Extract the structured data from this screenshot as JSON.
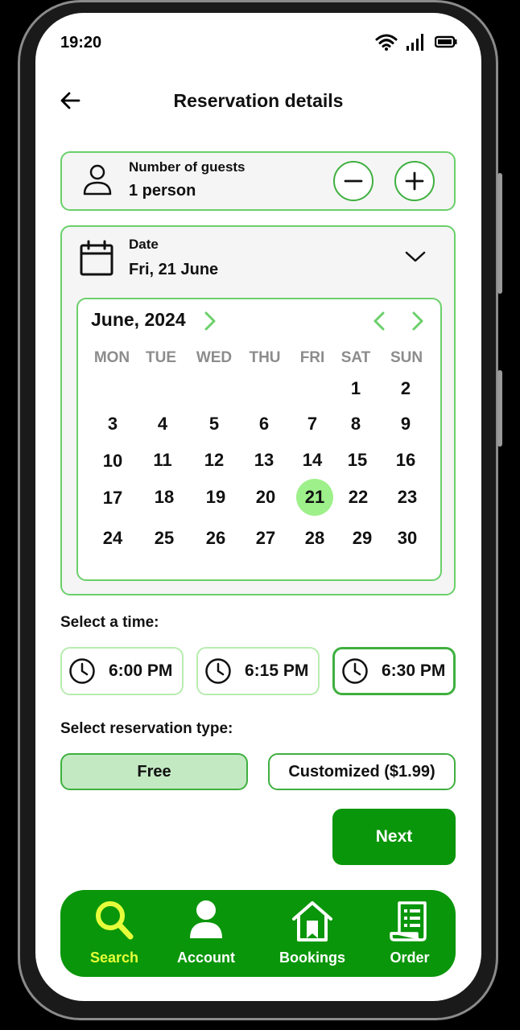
{
  "status": {
    "time": "19:20"
  },
  "header": {
    "title": "Reservation details"
  },
  "guests": {
    "label": "Number of guests",
    "value": "1 person"
  },
  "date": {
    "label": "Date",
    "value": "Fri, 21 June"
  },
  "calendar": {
    "month_title": "June, 2024",
    "weekdays": [
      "MON",
      "TUE",
      "WED",
      "THU",
      "FRI",
      "SAT",
      "SUN"
    ],
    "days": [
      "1",
      "2",
      "3",
      "4",
      "5",
      "6",
      "7",
      "8",
      "9",
      "10",
      "11",
      "12",
      "13",
      "14",
      "15",
      "16",
      "17",
      "18",
      "19",
      "20",
      "21",
      "22",
      "23",
      "24",
      "25",
      "26",
      "27",
      "28",
      "29",
      "30"
    ],
    "selected_day": "21"
  },
  "time_section": {
    "label": "Select a time:",
    "options": [
      "6:00 PM",
      "6:15 PM",
      "6:30 PM"
    ],
    "selected": "6:30 PM"
  },
  "reservation_type": {
    "label": "Select reservation type:",
    "options": [
      "Free",
      "Customized ($1.99)"
    ],
    "selected": "Free"
  },
  "next_label": "Next",
  "tabs": [
    {
      "label": "Search",
      "icon": "search-icon",
      "active": true
    },
    {
      "label": "Account",
      "icon": "account-icon",
      "active": false
    },
    {
      "label": "Bookings",
      "icon": "bookings-icon",
      "active": false
    },
    {
      "label": "Order",
      "icon": "order-icon",
      "active": false
    }
  ],
  "colors": {
    "accent": "#0a960a",
    "light_accent": "#6ad06a",
    "selected_day": "#9ef08a",
    "active_tab": "#e6ff3a",
    "free_bg": "#c3e9c3"
  }
}
